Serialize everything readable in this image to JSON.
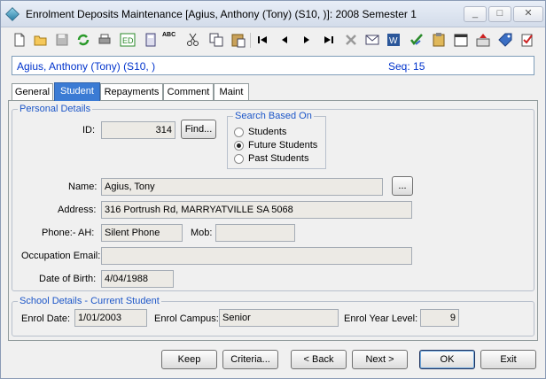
{
  "window": {
    "title": "Enrolment Deposits Maintenance  [Agius, Anthony (Tony) (S10, )]:  2008 Semester 1",
    "controls": {
      "minimize": "_",
      "maximize": "□",
      "close": "✕"
    }
  },
  "toolbar": {
    "icons": [
      "new-icon",
      "open-icon",
      "save-icon",
      "refresh-icon",
      "print-icon",
      "edit-icon",
      "calculator-icon",
      "spellcheck-icon",
      "cut-icon",
      "copy-icon",
      "paste-icon",
      "first-record-icon",
      "previous-record-icon",
      "next-record-icon",
      "last-record-icon",
      "delete-icon",
      "email-icon",
      "word-icon",
      "checklist-icon",
      "clipboard-icon",
      "calendar-icon",
      "report-icon",
      "tag-icon",
      "tasks-icon"
    ],
    "spellcheck_text": "ABC"
  },
  "header": {
    "student_name": "Agius, Anthony (Tony) (S10, )",
    "seq_label": "Seq: 15"
  },
  "tabs": [
    {
      "label": "General",
      "active": false
    },
    {
      "label": "Student",
      "active": true
    },
    {
      "label": "Repayments",
      "active": false
    },
    {
      "label": "Comment",
      "active": false
    },
    {
      "label": "Maint",
      "active": false
    }
  ],
  "personal": {
    "legend": "Personal Details",
    "id_label": "ID:",
    "id_value": "314",
    "find_button": "Find...",
    "search_group": {
      "title": "Search Based On",
      "options": [
        {
          "label": "Students",
          "selected": false
        },
        {
          "label": "Future Students",
          "selected": true
        },
        {
          "label": "Past Students",
          "selected": false
        }
      ]
    },
    "name_label": "Name:",
    "name_value": "Agius, Tony",
    "ellipsis_button": "...",
    "address_label": "Address:",
    "address_value": "316 Portrush Rd, MARRYATVILLE SA 5068",
    "phone_label": "Phone:-  AH:",
    "phone_value": "Silent Phone",
    "mob_label": "Mob:",
    "mob_value": "",
    "email_label": "Occupation Email:",
    "email_value": "",
    "dob_label": "Date of Birth:",
    "dob_value": "4/04/1988"
  },
  "school": {
    "legend": "School Details - Current Student",
    "enrol_date_label": "Enrol Date:",
    "enrol_date_value": "1/01/2003",
    "campus_label": "Enrol Campus:",
    "campus_value": "Senior",
    "year_label": "Enrol Year Level:",
    "year_value": "9"
  },
  "buttons": {
    "keep": "Keep",
    "criteria": "Criteria...",
    "back": "< Back",
    "next": "Next >",
    "ok": "OK",
    "exit": "Exit"
  }
}
